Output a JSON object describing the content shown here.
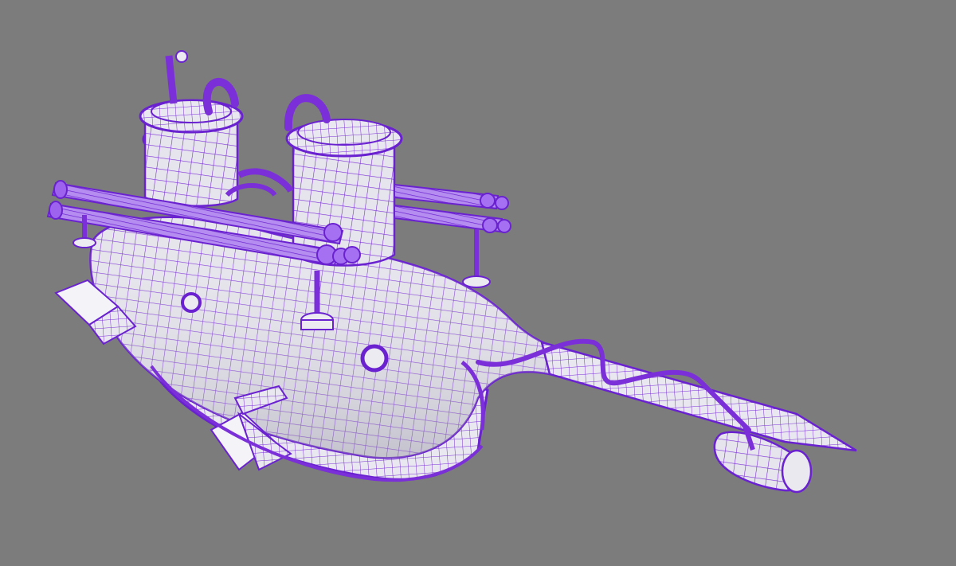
{
  "viewport": {
    "background_color": "#7c7c7c",
    "shaded_surface_color": "#e8e6ee",
    "wireframe_color": "#7b2fd8",
    "selection_highlight_color": "#8a3cff"
  },
  "model": {
    "subject": "submarine-wireframe-model"
  }
}
